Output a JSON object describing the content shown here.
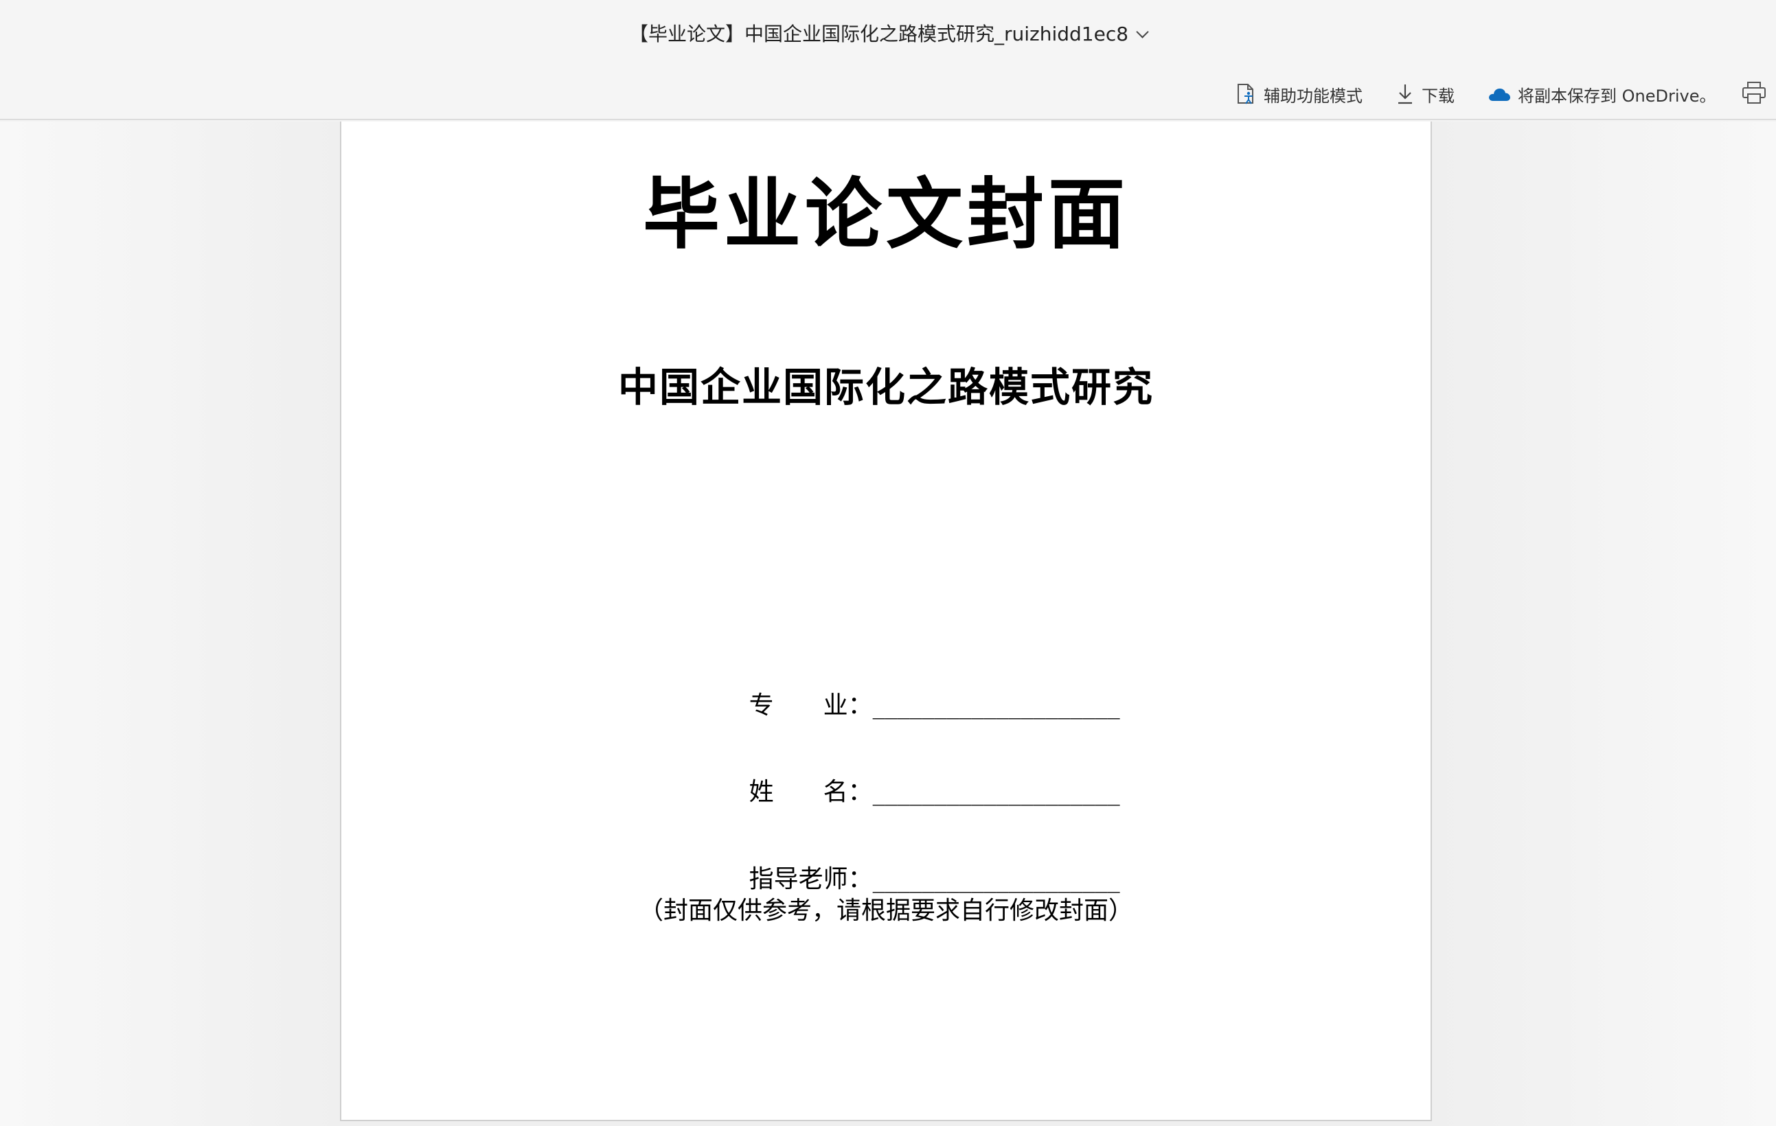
{
  "window": {
    "document_title": "【毕业论文】中国企业国际化之路模式研究_ruizhidd1ec8"
  },
  "toolbar": {
    "accessibility_label": "辅助功能模式",
    "download_label": "下载",
    "save_onedrive_label": "将副本保存到 OneDrive。",
    "icons": [
      "accessibility-icon",
      "download-icon",
      "onedrive-cloud-icon",
      "print-icon"
    ]
  },
  "document": {
    "cover_title": "毕业论文封面",
    "thesis_title": "中国企业国际化之路模式研究",
    "fields": [
      {
        "label": "专　　业：",
        "value": "____________________"
      },
      {
        "label": "姓　　名：",
        "value": "____________________"
      },
      {
        "label": "指导老师：",
        "value": "____________________"
      }
    ],
    "note": "（封面仅供参考，请根据要求自行修改封面）"
  },
  "colors": {
    "toolbar_bg": "#f5f5f5",
    "canvas_bg": "#efefef",
    "page_bg": "#ffffff",
    "onedrive_blue": "#0f6cbd"
  }
}
